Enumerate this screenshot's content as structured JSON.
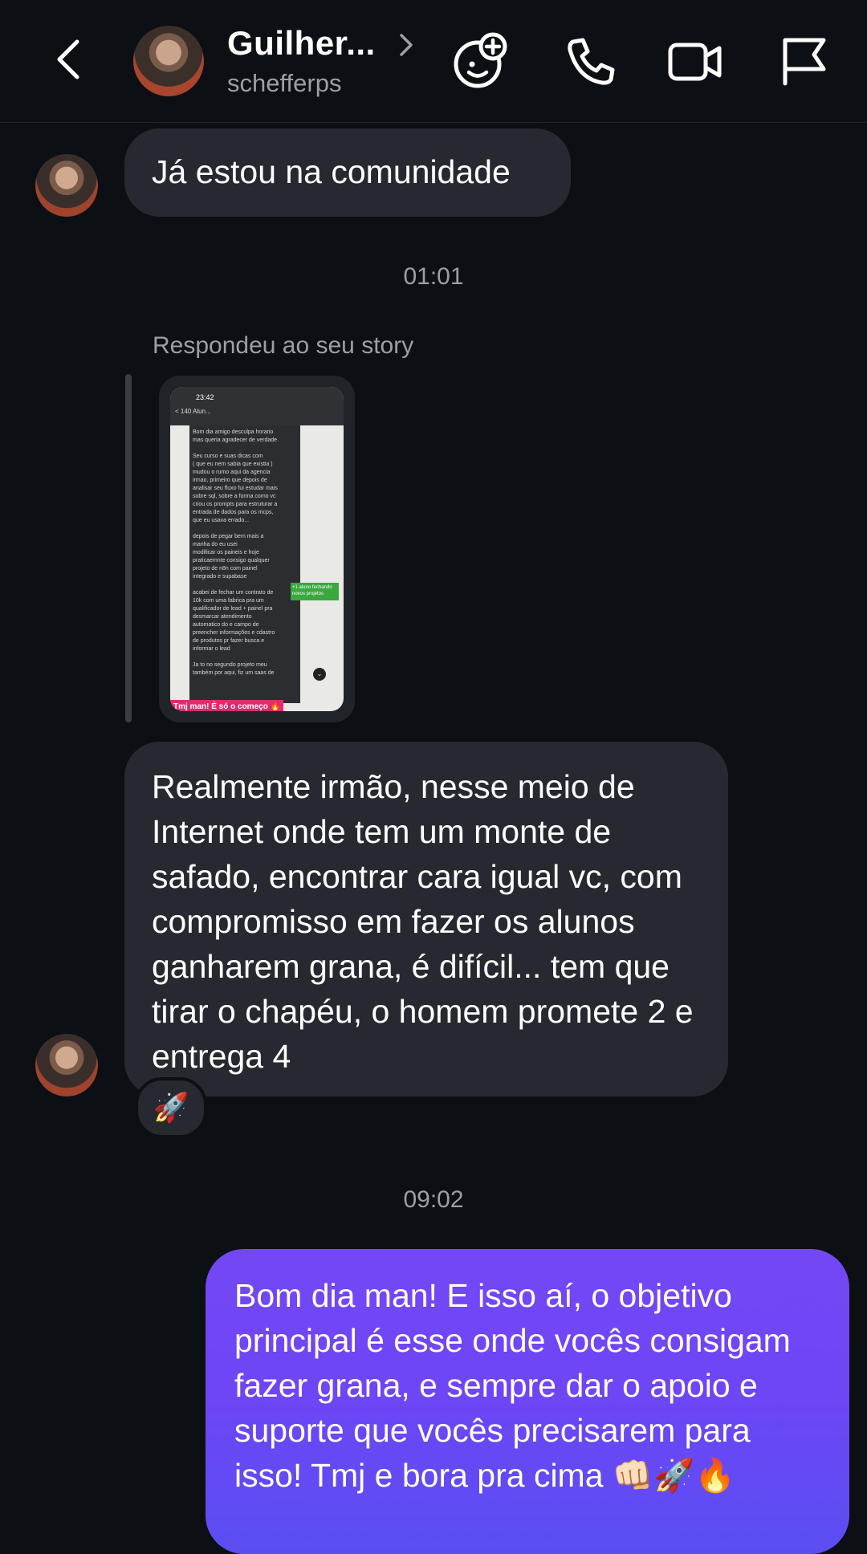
{
  "header": {
    "contact_name": "Guilher...",
    "username": "schefferps"
  },
  "colors": {
    "background": "#0c0f13",
    "incoming_bubble": "#262a30",
    "outgoing_gradient_top": "#7447f5",
    "outgoing_gradient_bottom": "#5a4ef2",
    "meta_text": "#9aa0a6"
  },
  "icons": {
    "back": "back-arrow-icon",
    "chevron": "chevron-right-icon",
    "effects": "face-plus-icon",
    "call": "phone-icon",
    "video": "video-camera-icon",
    "report": "flag-icon"
  },
  "messages": {
    "m1": "Já estou na comunidade",
    "time1": "01:01",
    "story_label": "Respondeu ao seu story",
    "m2": "Realmente irmão, nesse meio de Internet onde tem um monte de safado, encontrar cara igual vc, com compromisso em fazer os alunos ganharem grana, é difícil... tem que tirar o chapéu, o homem promete 2 e entrega 4",
    "reaction": "🚀",
    "time2": "09:02",
    "m3": "Bom dia man! E isso aí, o objetivo principal é esse onde vocês consigam fazer grana, e sempre dar o apoio e suporte que vocês precisarem para isso! Tmj e bora pra cima 👊🏻🚀🔥"
  },
  "story": {
    "time": "23:42",
    "nav": "< 140    Alun...",
    "green_sticker": "+1 aluno fechando novos projetos",
    "pink_sticker": "Tmj man! É só o começo 🔥",
    "lines": [
      "Bom dia amigo desculpa horario",
      "mas queria agradecer de verdade.",
      "",
      "Seu curso e suas dicas com",
      "( que eu nem sabia que existia )",
      "mudou o rumo aqui da agencia",
      "irmao, primeiro que depois de",
      "analisar seu fluxo fui estudar mais",
      "sobre sql, sobre a forma como vc",
      "criou os prompts para estruturar a",
      "entrada de dados para os mcps,",
      "que eu usava errado...",
      "",
      "depois de pegar bem mais a",
      "manha do     eu usei",
      "modificar os paineis e hoje",
      "praticaemnte consigo qualquer",
      "projeto de n8n com painel",
      "integrado e supabase",
      "",
      "acabei de fechar um contrato de",
      "10k com uma fabrica pra um",
      "qualificador de lead + painel pra",
      "desmarcar atendimento",
      "automatico do    e campo de",
      "preencher informações e cdastro",
      "de produtos pr    fazer busca e",
      "informar o lead",
      "",
      "Ja to no segundo projeto meu",
      "também por aqui, fiz um saas de"
    ]
  }
}
